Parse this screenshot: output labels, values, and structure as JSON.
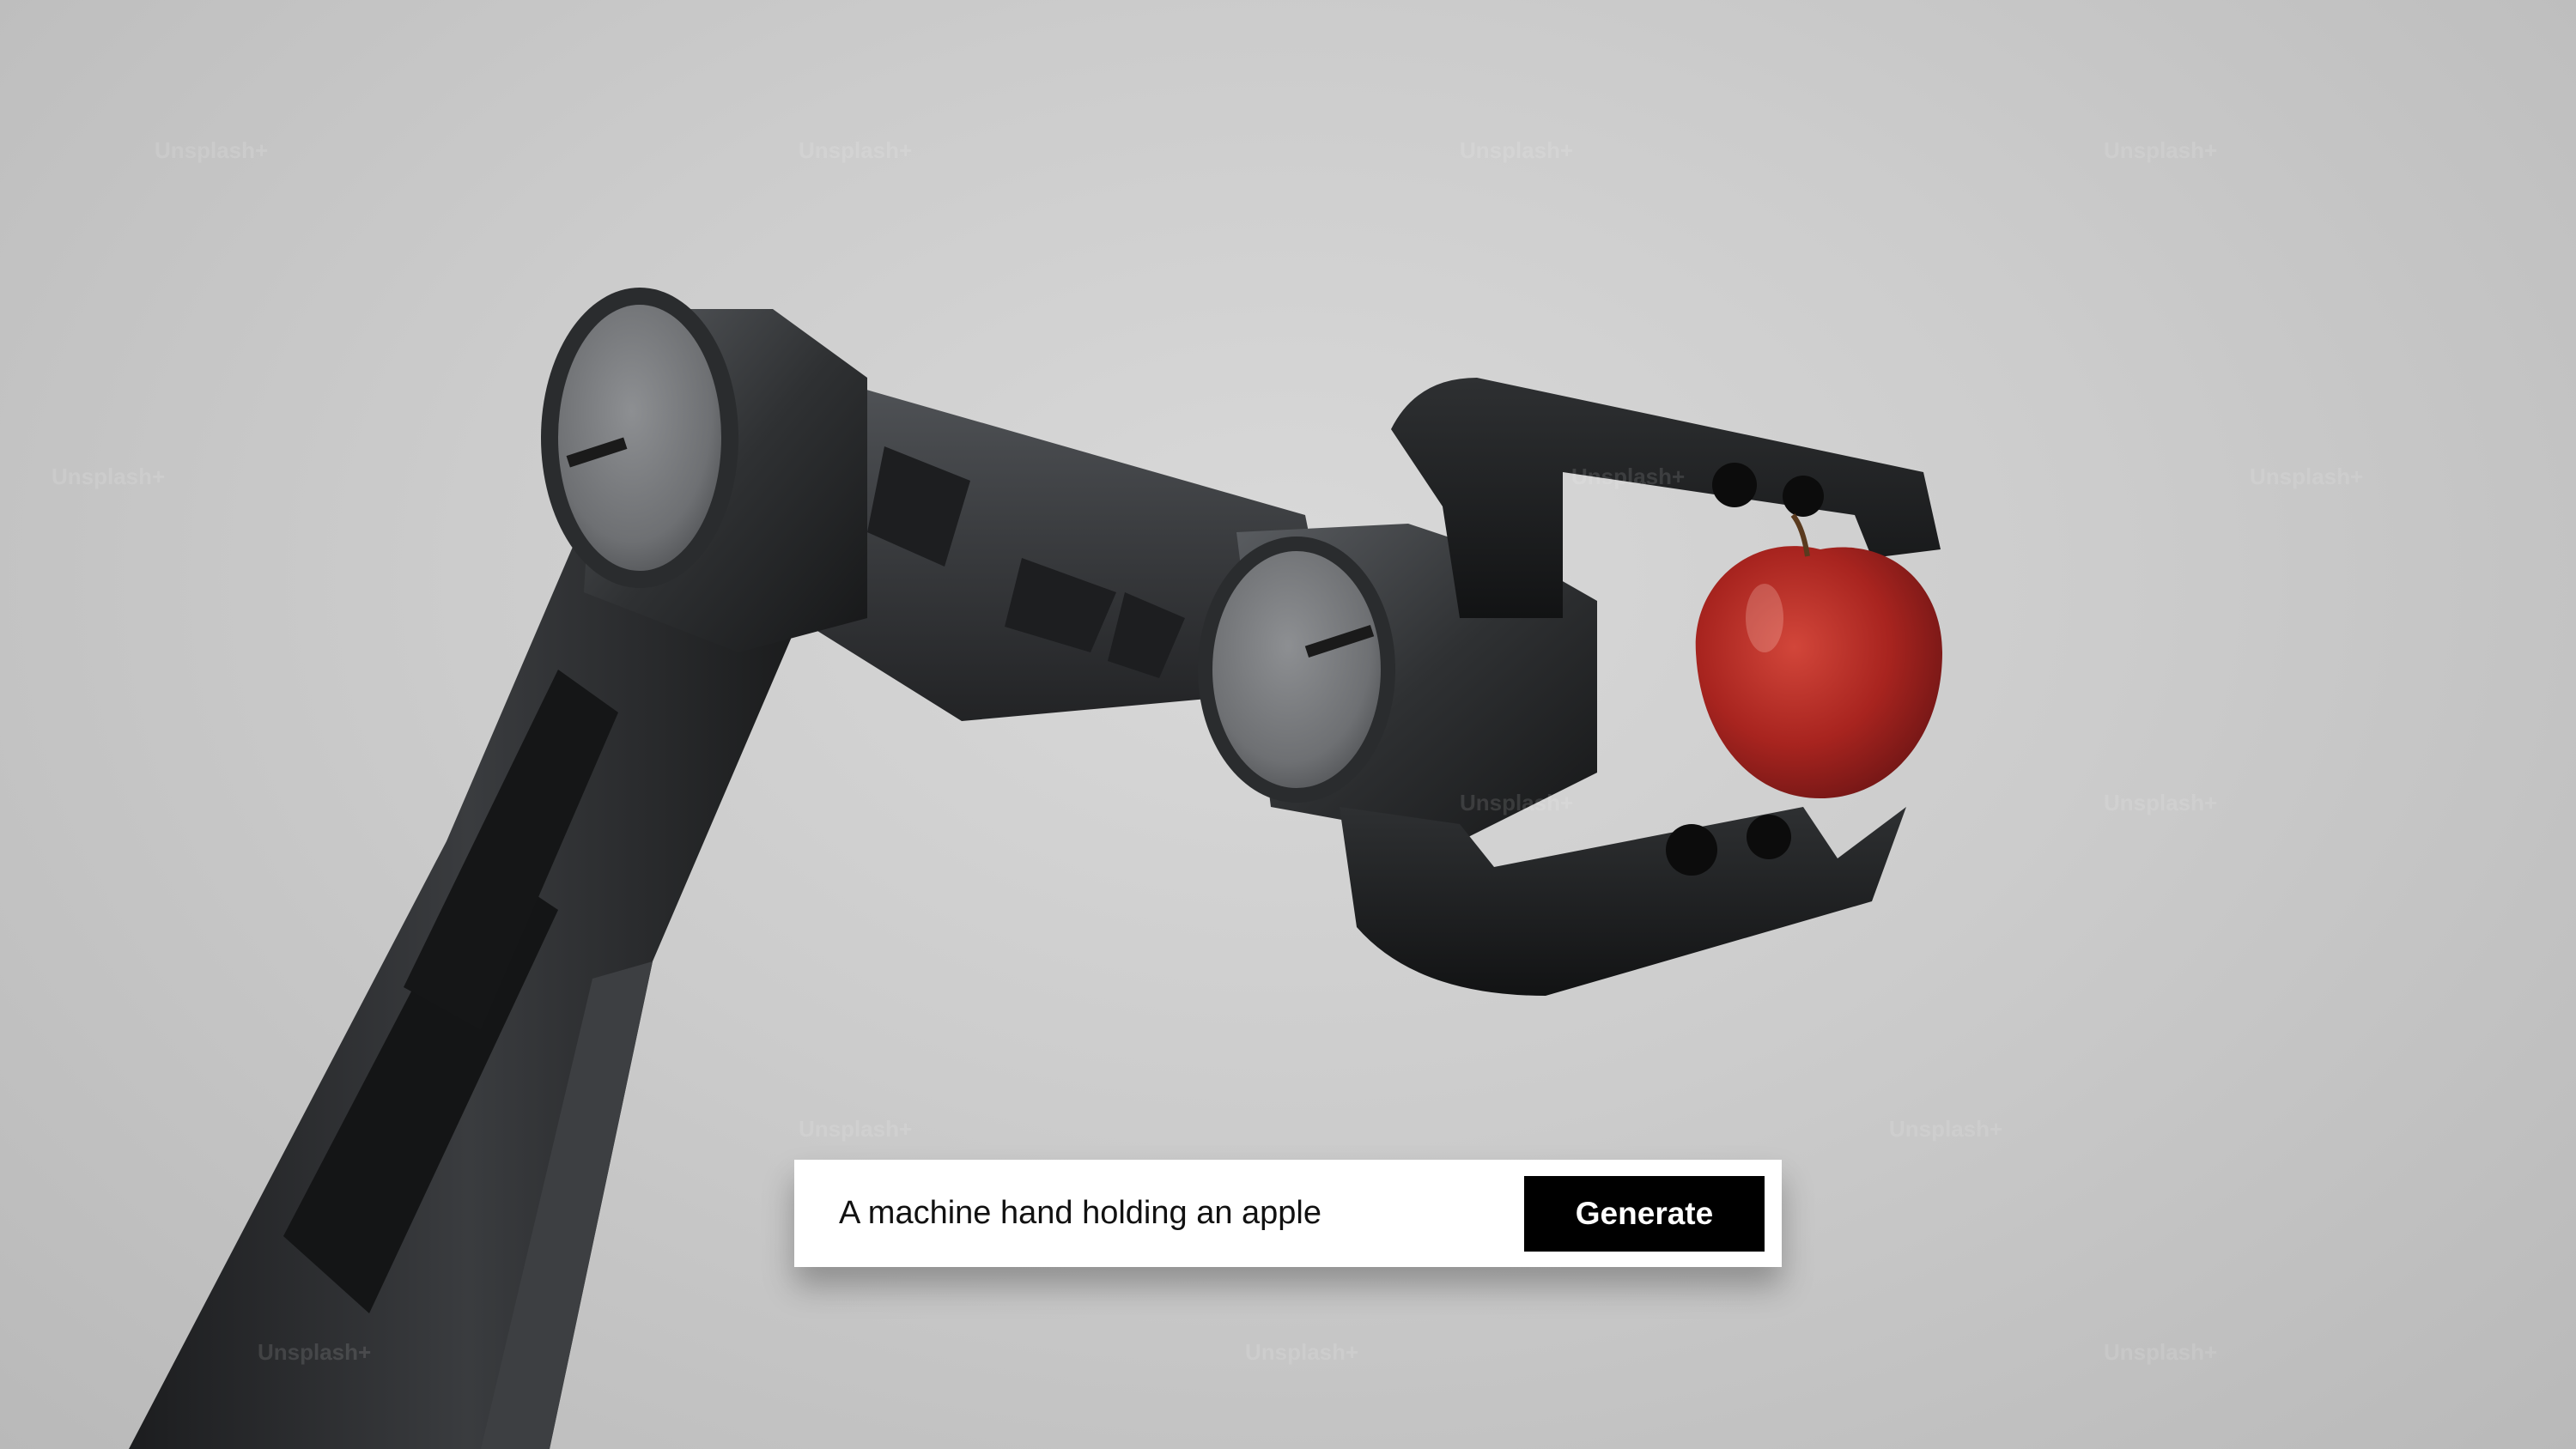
{
  "prompt": {
    "text": "A machine hand holding an apple",
    "button_label": "Generate"
  },
  "watermark": {
    "text": "Unsplash+"
  },
  "image": {
    "subject": "robotic-arm-holding-apple"
  },
  "colors": {
    "background": "#c8c8c8",
    "button": "#000000",
    "button_text": "#ffffff",
    "prompt_bg": "#ffffff",
    "apple": "#b52a26",
    "arm": "#2b2d2f"
  }
}
